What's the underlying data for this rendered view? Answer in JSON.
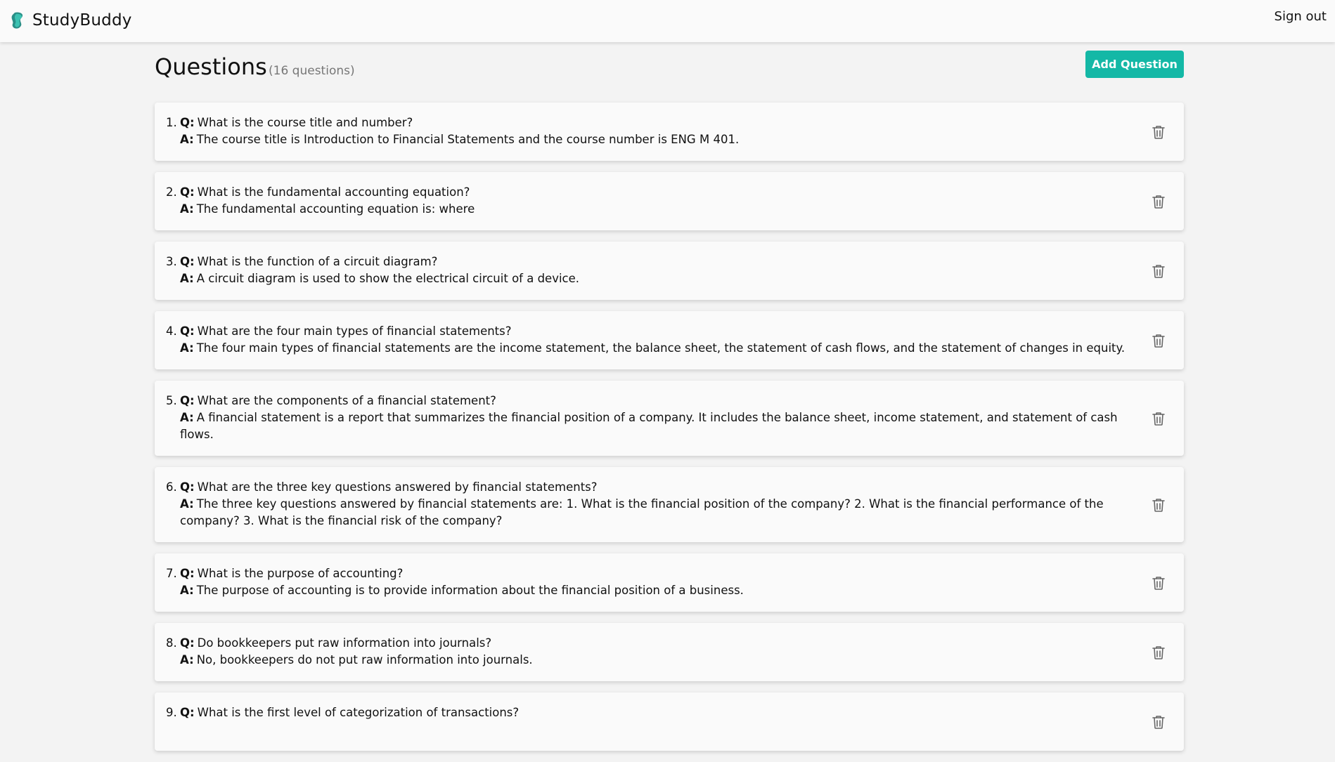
{
  "app": {
    "brand_name": "StudyBuddy",
    "logo_icon": "studybuddy-logo-icon",
    "brand_color": "#14b8a6",
    "signout_label": "Sign out"
  },
  "page": {
    "title": "Questions",
    "count_text": "(16 questions)",
    "add_button_label": "Add Question"
  },
  "labels": {
    "q": "Q:",
    "a": "A:"
  },
  "delete_icon": "trash-icon",
  "questions": [
    {
      "number": "1.",
      "question": "What is the course title and number?",
      "answer": "The course title is Introduction to Financial Statements and the course number is ENG M 401."
    },
    {
      "number": "2.",
      "question": "What is the fundamental accounting equation?",
      "answer": "The fundamental accounting equation is: where"
    },
    {
      "number": "3.",
      "question": "What is the function of a circuit diagram?",
      "answer": "A circuit diagram is used to show the electrical circuit of a device."
    },
    {
      "number": "4.",
      "question": "What are the four main types of financial statements?",
      "answer": "The four main types of financial statements are the income statement, the balance sheet, the statement of cash flows, and the statement of changes in equity."
    },
    {
      "number": "5.",
      "question": "What are the components of a financial statement?",
      "answer": "A financial statement is a report that summarizes the financial position of a company. It includes the balance sheet, income statement, and statement of cash flows."
    },
    {
      "number": "6.",
      "question": "What are the three key questions answered by financial statements?",
      "answer": "The three key questions answered by financial statements are: 1. What is the financial position of the company? 2. What is the financial performance of the company? 3. What is the financial risk of the company?"
    },
    {
      "number": "7.",
      "question": "What is the purpose of accounting?",
      "answer": "The purpose of accounting is to provide information about the financial position of a business."
    },
    {
      "number": "8.",
      "question": "Do bookkeepers put raw information into journals?",
      "answer": "No, bookkeepers do not put raw information into journals."
    },
    {
      "number": "9.",
      "question": "What is the first level of categorization of transactions?",
      "answer": ""
    }
  ]
}
